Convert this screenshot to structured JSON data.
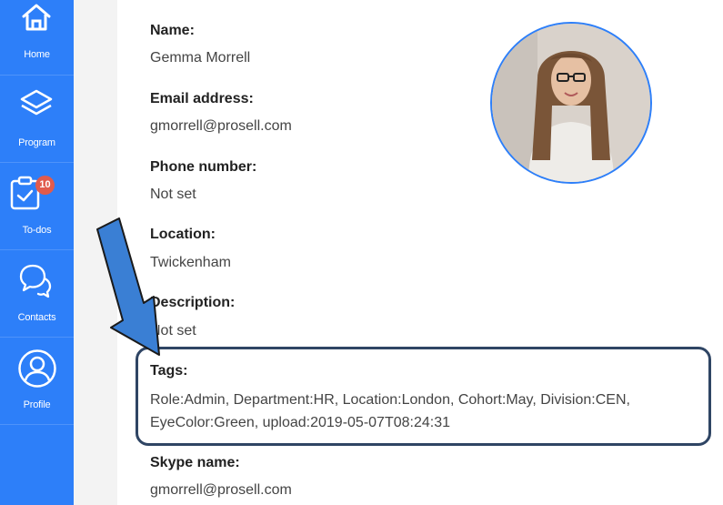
{
  "sidebar": {
    "items": [
      {
        "label": "Home",
        "icon": "home-icon"
      },
      {
        "label": "Program",
        "icon": "layers-icon"
      },
      {
        "label": "To-dos",
        "icon": "clipboard-check-icon",
        "badge": "10"
      },
      {
        "label": "Contacts",
        "icon": "chat-bubbles-icon"
      },
      {
        "label": "Profile",
        "icon": "user-circle-icon"
      }
    ],
    "colors": {
      "background": "#2d7ff9",
      "badge": "#e15b4c"
    }
  },
  "profile": {
    "name_label": "Name:",
    "name_value": "Gemma Morrell",
    "email_label": "Email address:",
    "email_value": "gmorrell@prosell.com",
    "phone_label": "Phone number:",
    "phone_value": "Not set",
    "location_label": "Location:",
    "location_value": "Twickenham",
    "description_label": "Description:",
    "description_value": "Not set",
    "tags_label": "Tags:",
    "tags_value": "Role:Admin, Department:HR, Location:London, Cohort:May, Division:CEN, EyeColor:Green, upload:2019-05-07T08:24:31",
    "skype_label": "Skype name:",
    "skype_value": "gmorrell@prosell.com"
  },
  "annotation": {
    "arrow_color": "#3a7fd4",
    "box_color": "#2f4564"
  }
}
